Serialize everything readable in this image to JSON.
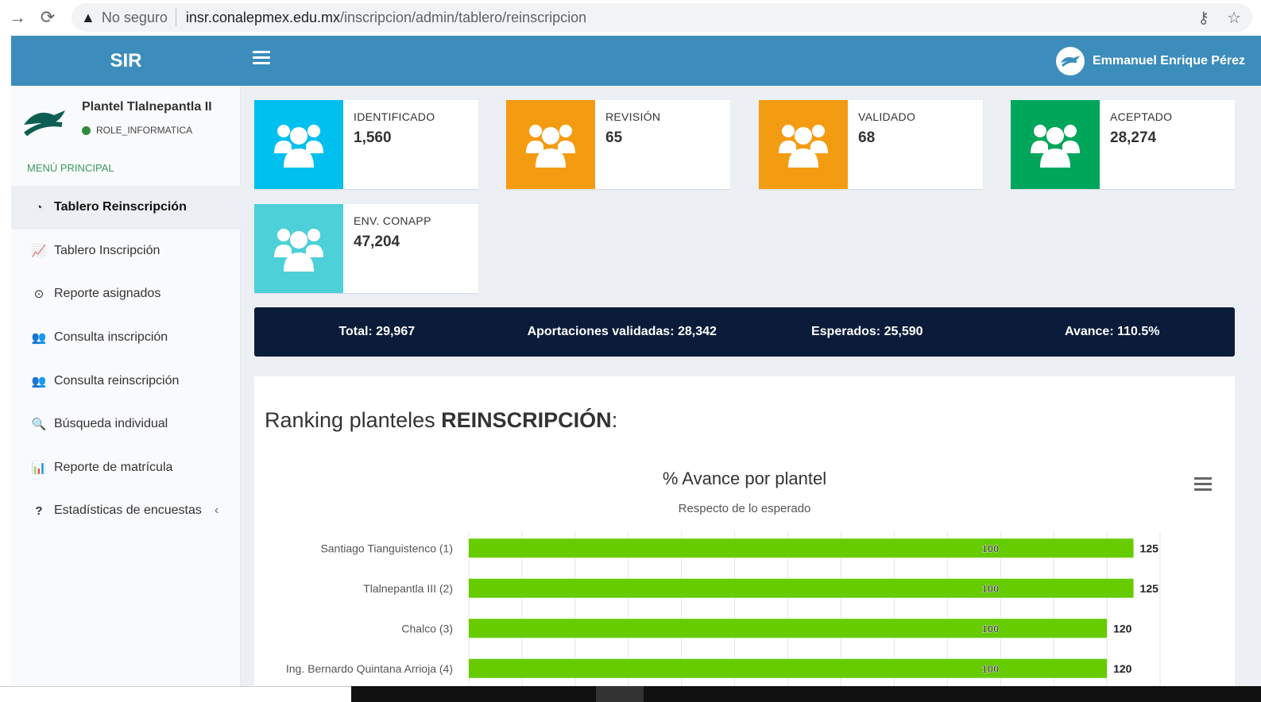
{
  "browser": {
    "security_label": "No seguro",
    "url_host": "insr.conalepmex.edu.mx",
    "url_path": "/inscripcion/admin/tablero/reinscripcion"
  },
  "app": {
    "brand": "SIR",
    "user_name": "Emmanuel Enrique Pérez"
  },
  "sidebar": {
    "plantel": "Plantel Tlalnepantla II",
    "role": "ROLE_INFORMATICA",
    "menu_header": "MENÚ PRINCIPAL",
    "items": [
      {
        "label": "Tablero Reinscripción",
        "icon": "dashboard-icon"
      },
      {
        "label": "Tablero Inscripción",
        "icon": "line-chart-icon"
      },
      {
        "label": "Reporte asignados",
        "icon": "circle-check-icon"
      },
      {
        "label": "Consulta inscripción",
        "icon": "users-icon"
      },
      {
        "label": "Consulta reinscripción",
        "icon": "users-icon"
      },
      {
        "label": "Búsqueda individual",
        "icon": "search-icon"
      },
      {
        "label": "Reporte de matrícula",
        "icon": "bar-chart-icon"
      },
      {
        "label": "Estadísticas de encuestas",
        "icon": "question-icon"
      }
    ]
  },
  "cards": [
    {
      "label": "IDENTIFICADO",
      "value": "1,560",
      "color": "#00c0ef"
    },
    {
      "label": "REVISIÓN",
      "value": "65",
      "color": "#f39c12"
    },
    {
      "label": "VALIDADO",
      "value": "68",
      "color": "#f39c12"
    },
    {
      "label": "ACEPTADO",
      "value": "28,274",
      "color": "#00a65a"
    },
    {
      "label": "ENV. CONAPP",
      "value": "47,204",
      "color": "#4dd0d8"
    }
  ],
  "summary": {
    "total": "Total: 29,967",
    "aportaciones": "Aportaciones validadas: 28,342",
    "esperados": "Esperados: 25,590",
    "avance": "Avance: 110.5%"
  },
  "ranking": {
    "title_prefix": "Ranking planteles ",
    "title_bold": "REINSCRIPCIÓN",
    "title_suffix": ":"
  },
  "chart_data": {
    "type": "bar",
    "orientation": "horizontal",
    "title": "% Avance por plantel",
    "subtitle": "Respecto de lo esperado",
    "categories": [
      "Santiago Tianguistenco (1)",
      "Tlalnepantla III (2)",
      "Chalco (3)",
      "Ing. Bernardo Quintana Arrioja (4)"
    ],
    "values": [
      125,
      125,
      120,
      120
    ],
    "reference_values": [
      100,
      100,
      100,
      100
    ],
    "xlim": [
      0,
      130
    ],
    "grid": true,
    "bar_color": "#66cc00"
  }
}
